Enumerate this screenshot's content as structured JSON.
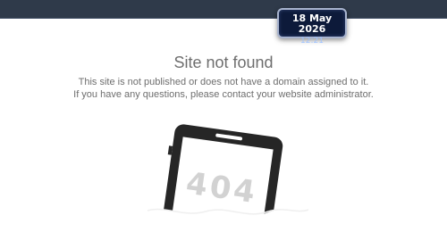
{
  "clock": {
    "date": "18 May 2026",
    "time": "12:21"
  },
  "page": {
    "title": "Site not found",
    "line1": "This site is not published or does not have a domain assigned to it.",
    "line2": "If you have any questions, please contact your website administrator."
  },
  "illustration": {
    "error_code": "404",
    "icon": "tablet-404-icon"
  },
  "colors": {
    "topbar": "#2f3a4a",
    "clock_bg": "#0d1a3a",
    "clock_time": "#9fc3ff",
    "text": "#6e6e6e",
    "device": "#262626",
    "error_code": "#d2d2d2"
  }
}
